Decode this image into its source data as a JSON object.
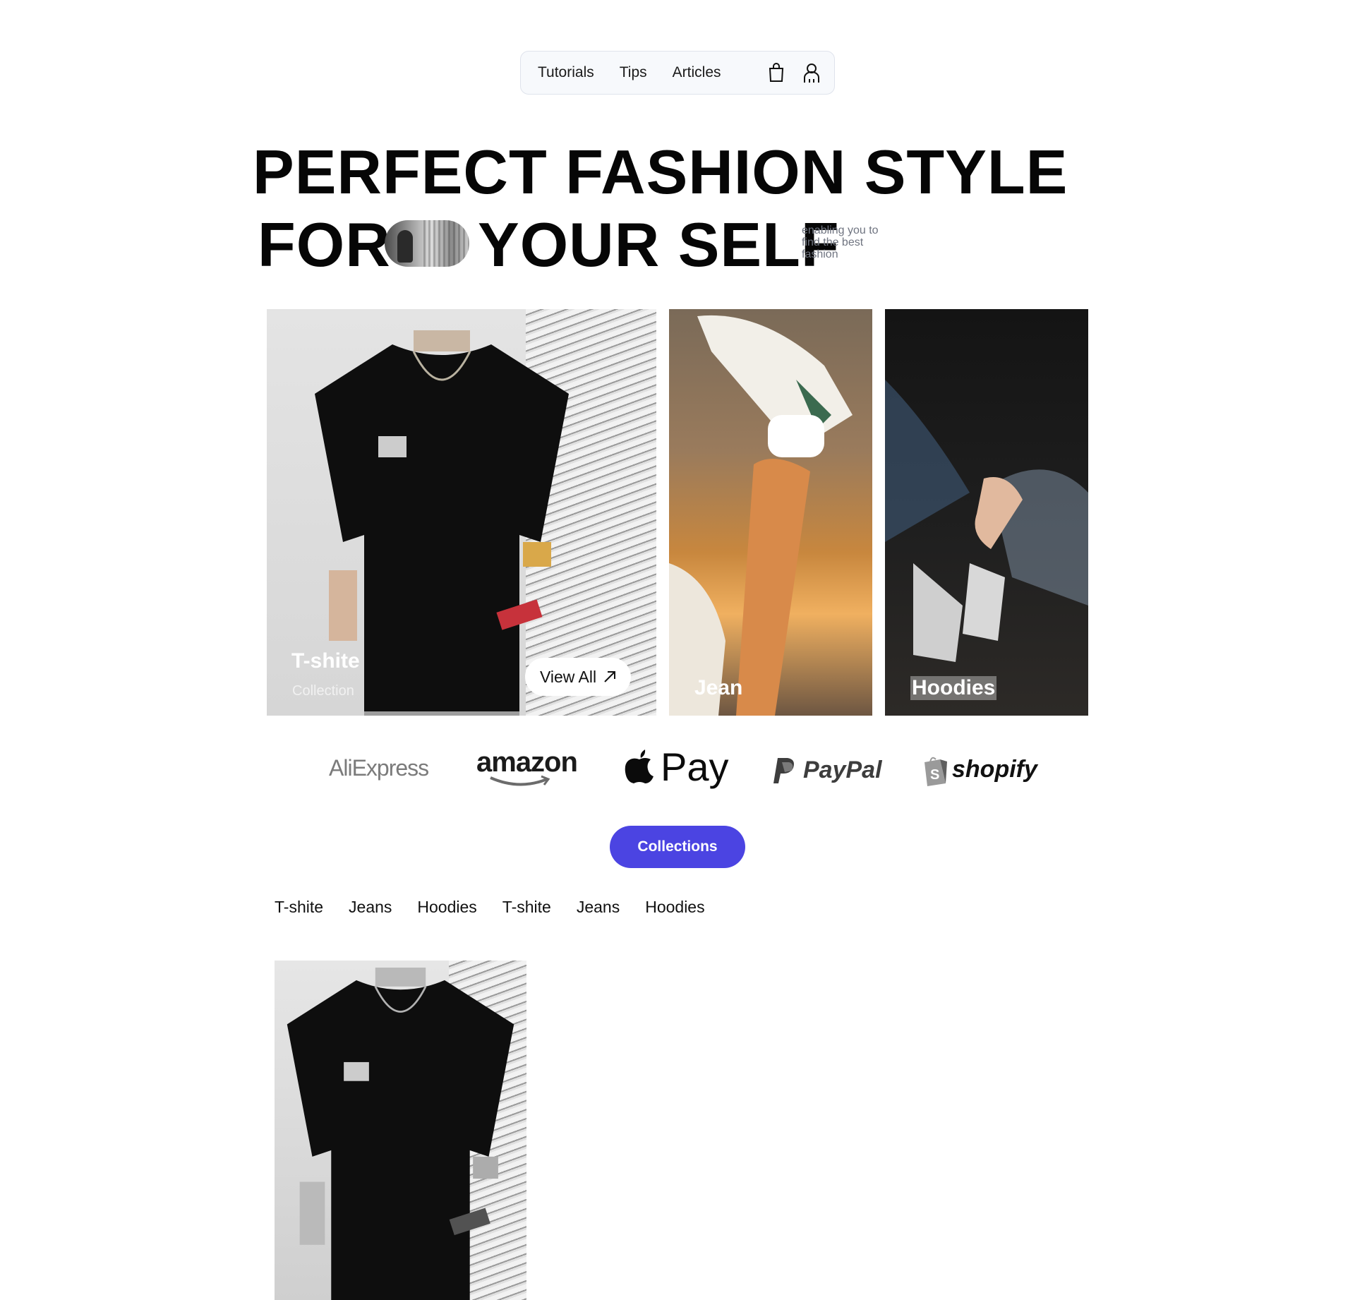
{
  "nav": {
    "links": [
      "Tutorials",
      "Tips",
      "Articles"
    ],
    "icons": [
      "shopping-bag-icon",
      "user-icon"
    ]
  },
  "hero": {
    "line1": "PERFECT FASHION STYLE",
    "line2_start": "FOR",
    "line2_end": "YOUR SELF",
    "subtitle": "enabling you to find the best fashion"
  },
  "cards": [
    {
      "title": "T-shite",
      "subtitle": "Collection",
      "button": "View All"
    },
    {
      "title": "Jean"
    },
    {
      "title": "Hoodies"
    }
  ],
  "brands": {
    "aliexpress": "AliExpress",
    "amazon": "amazon",
    "applepay": "Pay",
    "paypal": "PayPal",
    "shopify": "shopify"
  },
  "collections": {
    "button": "Collections",
    "tabs": [
      "T-shite",
      "Jeans",
      "Hoodies",
      "T-shite",
      "Jeans",
      "Hoodies"
    ]
  }
}
